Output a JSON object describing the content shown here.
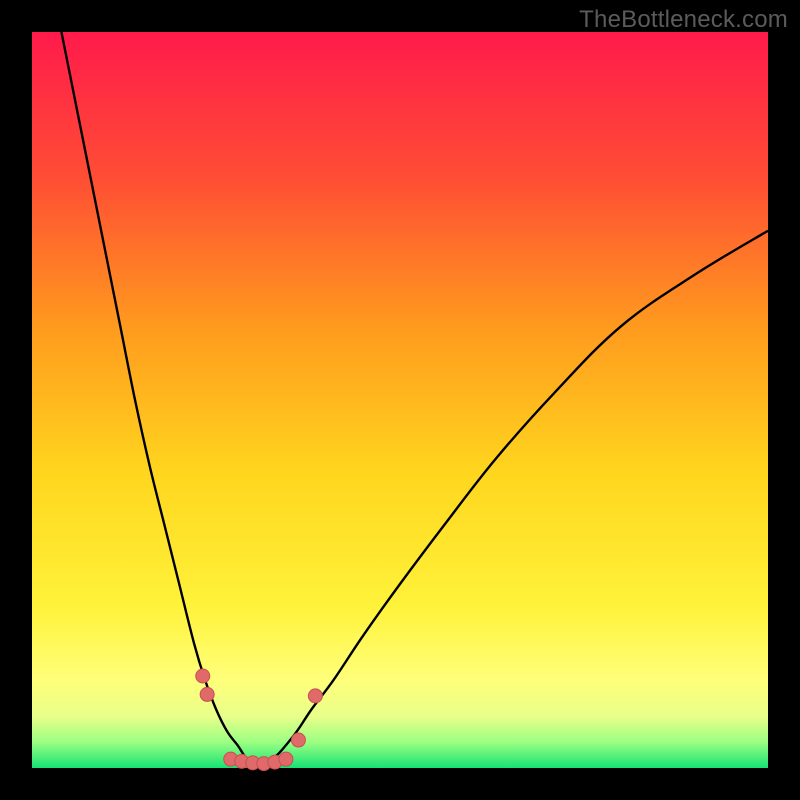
{
  "watermark": {
    "text": "TheBottleneck.com"
  },
  "colors": {
    "frame": "#000000",
    "gradient_stops": [
      {
        "pos": 0.0,
        "hex": "#ff1a4b"
      },
      {
        "pos": 0.2,
        "hex": "#ff4e34"
      },
      {
        "pos": 0.4,
        "hex": "#ff9a1e"
      },
      {
        "pos": 0.6,
        "hex": "#ffd61e"
      },
      {
        "pos": 0.78,
        "hex": "#fff23a"
      },
      {
        "pos": 0.88,
        "hex": "#ffff7a"
      },
      {
        "pos": 0.93,
        "hex": "#e8ff8a"
      },
      {
        "pos": 0.965,
        "hex": "#9bff82"
      },
      {
        "pos": 1.0,
        "hex": "#16e274"
      }
    ],
    "curve_stroke": "#000000",
    "marker_fill": "#e06a6a",
    "marker_stroke": "#c94f4f"
  },
  "chart_data": {
    "type": "line",
    "title": "",
    "xlabel": "",
    "ylabel": "",
    "x_range": [
      0,
      100
    ],
    "y_range": [
      0,
      100
    ],
    "series": [
      {
        "name": "left-curve",
        "x": [
          4,
          6,
          8,
          10,
          12,
          14,
          16,
          18,
          20,
          22,
          23.5,
          25,
          26.5,
          28,
          29,
          30,
          31
        ],
        "y": [
          100,
          90,
          80,
          70,
          60,
          50,
          41,
          33,
          25,
          17,
          12,
          8,
          5,
          3,
          1.5,
          0.8,
          0.2
        ]
      },
      {
        "name": "right-curve",
        "x": [
          31,
          32,
          33,
          34,
          36,
          38,
          41,
          45,
          50,
          56,
          63,
          71,
          80,
          90,
          100
        ],
        "y": [
          0.2,
          0.8,
          1.5,
          2.5,
          5,
          8,
          12,
          18,
          25,
          33,
          42,
          51,
          60,
          67,
          73
        ]
      }
    ],
    "markers": {
      "name": "bottleneck-markers",
      "points": [
        {
          "x": 23.2,
          "y": 12.5
        },
        {
          "x": 23.8,
          "y": 10.0
        },
        {
          "x": 27.0,
          "y": 1.2
        },
        {
          "x": 28.5,
          "y": 0.9
        },
        {
          "x": 30.0,
          "y": 0.7
        },
        {
          "x": 31.5,
          "y": 0.6
        },
        {
          "x": 33.0,
          "y": 0.8
        },
        {
          "x": 34.5,
          "y": 1.2
        },
        {
          "x": 36.2,
          "y": 3.8
        },
        {
          "x": 38.5,
          "y": 9.8
        }
      ],
      "radius": 7
    }
  }
}
